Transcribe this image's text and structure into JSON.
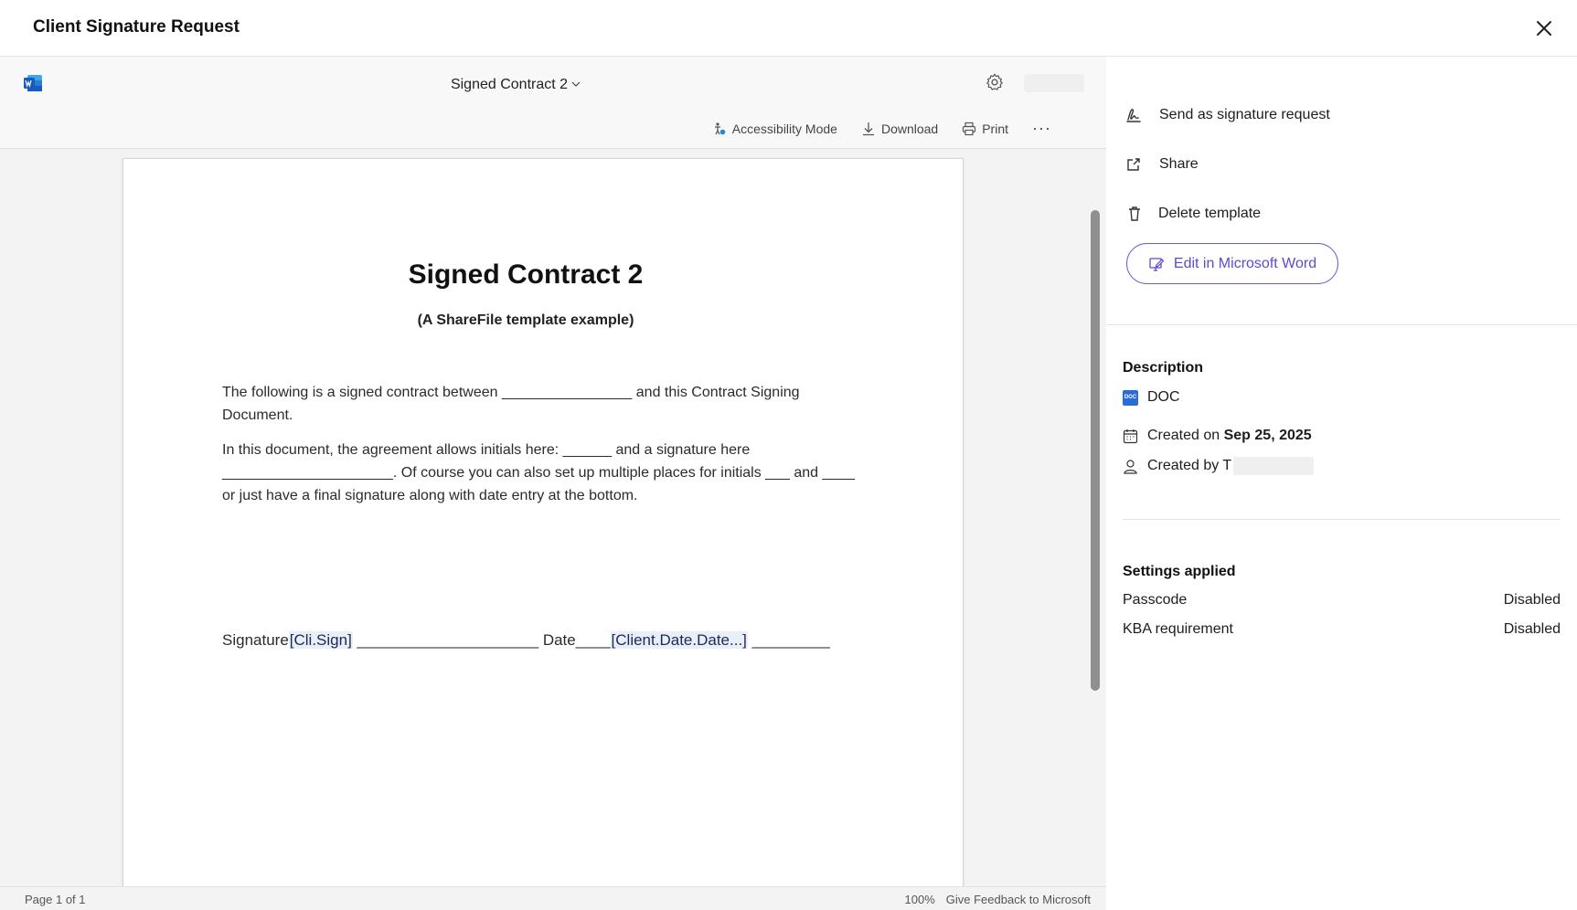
{
  "dialog": {
    "title": "Client Signature Request"
  },
  "viewer": {
    "file_name": "Signed Contract 2",
    "toolbar": {
      "accessibility_label": "Accessibility Mode",
      "download_label": "Download",
      "print_label": "Print",
      "more_label": "···"
    },
    "status": {
      "page_indicator": "Page 1 of 1",
      "zoom": "100%",
      "feedback_label": "Give Feedback to Microsoft"
    }
  },
  "document": {
    "heading": "Signed Contract 2",
    "subtitle": "(A ShareFile template example)",
    "paragraph1": "The following is a signed contract between ________________  and this Contract Signing Document.",
    "paragraph2": "In this document, the agreement allows initials here: ______  and a signature here _____________________.  Of course you can also set up multiple places for initials ___ and ____ or just have a final signature along with date entry at the bottom.",
    "sig_label": "Signature",
    "sig_tag": "[Cli.Sign]",
    "sig_line": " _____________________  ",
    "date_label": "Date____",
    "date_tag": "[Client.Date.Date...]",
    "date_line": "  _________"
  },
  "panel": {
    "actions": {
      "send_label": "Send as signature request",
      "share_label": "Share",
      "delete_label": "Delete template",
      "edit_label": "Edit in Microsoft Word"
    },
    "description": {
      "title": "Description",
      "file_type": "DOC",
      "file_type_badge": "DOC",
      "created_on_prefix": "Created on ",
      "created_on_date": "Sep 25, 2025",
      "created_by_prefix": "Created by T"
    },
    "settings": {
      "title": "Settings applied",
      "rows": [
        {
          "label": "Passcode",
          "value": "Disabled"
        },
        {
          "label": "KBA requirement",
          "value": "Disabled"
        }
      ]
    }
  },
  "colors": {
    "accent": "#5a4bd0",
    "word_blue": "#185abd",
    "tag_bg": "#e9eef8"
  },
  "icons": {
    "close": "close-icon",
    "word": "word-logo-icon",
    "settings": "gear-icon",
    "accessibility": "accessibility-icon",
    "download": "download-icon",
    "print": "print-icon",
    "signature": "signature-icon",
    "share": "share-icon",
    "delete": "trash-icon",
    "edit": "edit-icon",
    "calendar": "calendar-icon",
    "user": "user-icon"
  }
}
